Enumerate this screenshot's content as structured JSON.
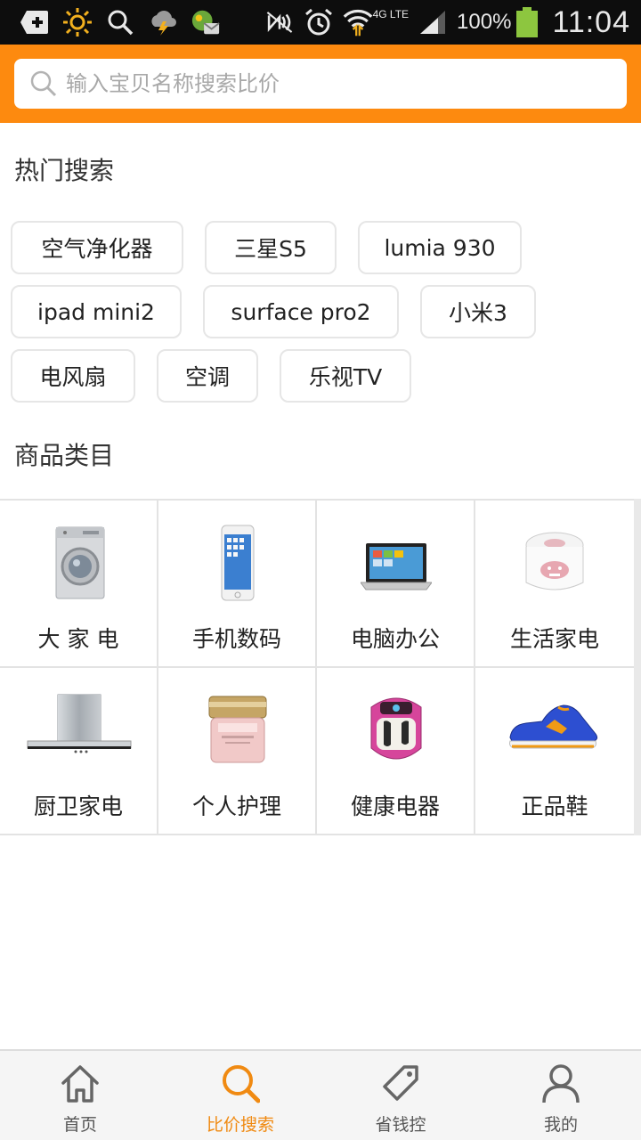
{
  "status_bar": {
    "network_label": "4G LTE",
    "battery_percent": "100%",
    "time": "11:04",
    "colors": {
      "background": "#0d0d0d",
      "battery": "#8dc63f"
    }
  },
  "search": {
    "placeholder": "输入宝贝名称搜索比价",
    "icon": "search-icon"
  },
  "hot_search": {
    "title": "热门搜索",
    "tags": [
      "空气净化器",
      "三星S5",
      "lumia 930",
      "ipad mini2",
      "surface pro2",
      "小米3",
      "电风扇",
      "空调",
      "乐视TV"
    ]
  },
  "categories": {
    "title": "商品类目",
    "items": [
      {
        "label": "大 家 电",
        "icon": "washing-machine-icon"
      },
      {
        "label": "手机数码",
        "icon": "smartphone-icon"
      },
      {
        "label": "电脑办公",
        "icon": "laptop-icon"
      },
      {
        "label": "生活家电",
        "icon": "rice-cooker-icon"
      },
      {
        "label": "厨卫家电",
        "icon": "range-hood-icon"
      },
      {
        "label": "个人护理",
        "icon": "cosmetic-jar-icon"
      },
      {
        "label": "健康电器",
        "icon": "foot-spa-icon"
      },
      {
        "label": "正品鞋",
        "icon": "sneaker-icon"
      }
    ]
  },
  "bottom_nav": {
    "items": [
      {
        "label": "首页",
        "icon": "home-icon",
        "active": false
      },
      {
        "label": "比价搜索",
        "icon": "search-icon",
        "active": true
      },
      {
        "label": "省钱控",
        "icon": "price-tag-icon",
        "active": false
      },
      {
        "label": "我的",
        "icon": "user-icon",
        "active": false
      }
    ]
  },
  "colors": {
    "accent": "#fd8a0f",
    "active_nav": "#f08a12",
    "border": "#e3e3e3"
  }
}
